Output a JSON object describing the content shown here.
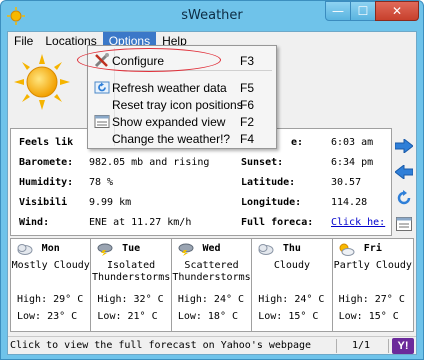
{
  "window": {
    "title": "sWeather",
    "min_glyph": "—",
    "max_glyph": "☐",
    "close_glyph": "✕"
  },
  "menu": {
    "file": "File",
    "locations": "Locations",
    "options": "Options",
    "help": "Help"
  },
  "options_menu": {
    "items": [
      {
        "label": "Configure",
        "shortcut": "F3",
        "icon": "wrench-icon"
      },
      {
        "label": "Refresh weather data",
        "shortcut": "F5",
        "icon": "refresh-icon"
      },
      {
        "label": "Reset tray icon positions",
        "shortcut": "F6",
        "icon": ""
      },
      {
        "label": "Show expanded view",
        "shortcut": "F2",
        "icon": "expanded-view-icon"
      },
      {
        "label": "Change the weather!?",
        "shortcut": "F4",
        "icon": ""
      }
    ]
  },
  "details": {
    "feels_like_label": "Feels lik",
    "barometer_label": "Baromete:",
    "barometer_value": "982.05 mb and rising",
    "humidity_label": "Humidity:",
    "humidity_value": "78 %",
    "visibility_label": "Visibili",
    "visibility_value": "9.99 km",
    "wind_label": "Wind:",
    "wind_value": "ENE at 11.27 km/h",
    "sunrise_label": "e:",
    "sunrise_value": "6:03 am",
    "sunset_label": "Sunset:",
    "sunset_value": "6:34 pm",
    "latitude_label": "Latitude:",
    "latitude_value": "30.57",
    "longitude_label": "Longitude:",
    "longitude_value": "114.28",
    "full_forecast_label": "Full foreca:",
    "full_forecast_link": "Click he:"
  },
  "forecast": [
    {
      "day": "Mon",
      "cond1": "Mostly Cloudy",
      "cond2": "",
      "high": "High: 29° C",
      "low": "Low: 23° C",
      "icon": "cloud-icon"
    },
    {
      "day": "Tue",
      "cond1": "Isolated",
      "cond2": "Thunderstorms",
      "high": "High: 32° C",
      "low": "Low: 21° C",
      "icon": "storm-icon"
    },
    {
      "day": "Wed",
      "cond1": "Scattered",
      "cond2": "Thunderstorms",
      "high": "High: 24° C",
      "low": "Low: 18° C",
      "icon": "storm-icon"
    },
    {
      "day": "Thu",
      "cond1": "Cloudy",
      "cond2": "",
      "high": "High: 24° C",
      "low": "Low: 15° C",
      "icon": "cloud-icon"
    },
    {
      "day": "Fri",
      "cond1": "Partly Cloudy",
      "cond2": "",
      "high": "High: 27° C",
      "low": "Low: 15° C",
      "icon": "partly-cloudy-icon"
    }
  ],
  "status": {
    "text": "Click to view the full forecast on Yahoo's webpage",
    "page": "1/1",
    "badge": "Y!"
  },
  "colors": {
    "title_bar": "#6fc3ea",
    "menu_highlight": "#3b78c8",
    "annotation": "#e0303a",
    "link": "#0000cc"
  }
}
